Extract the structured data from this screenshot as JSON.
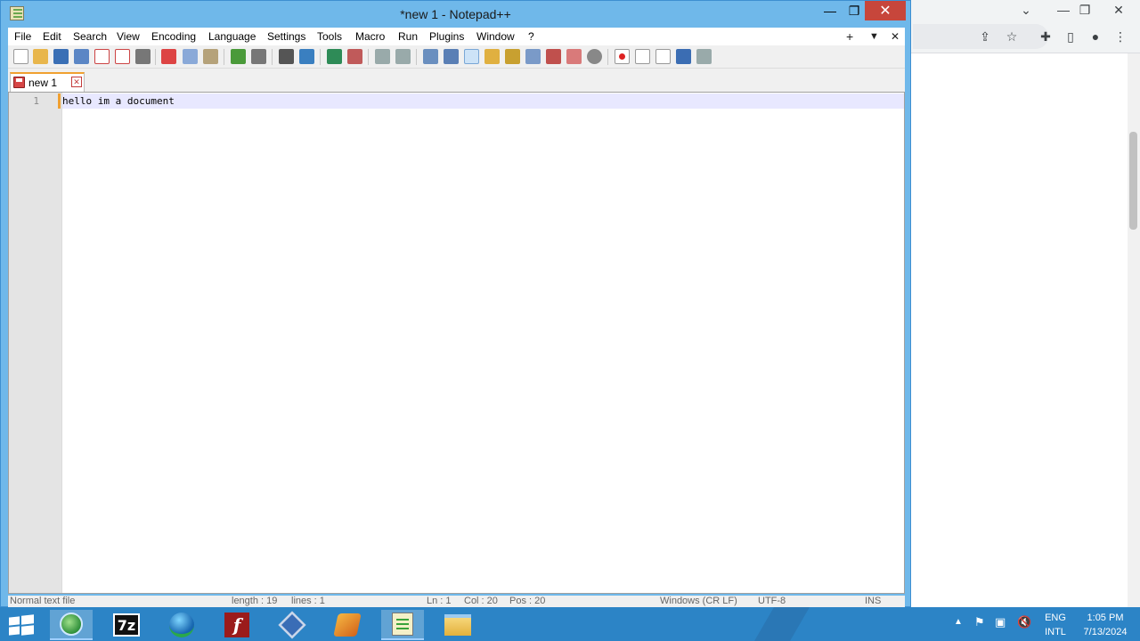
{
  "window": {
    "title": "*new 1 - Notepad++",
    "close_glyph": "✕",
    "minimize_glyph": "—",
    "maximize_glyph": "❐"
  },
  "menu": {
    "items": [
      "File",
      "Edit",
      "Search",
      "View",
      "Encoding",
      "Language",
      "Settings",
      "Tools",
      "Macro",
      "Run",
      "Plugins",
      "Window",
      "?"
    ],
    "right_glyphs": [
      "+",
      "▼",
      "✕"
    ]
  },
  "tabs": [
    {
      "label": "new 1",
      "close_glyph": "✕",
      "modified": true
    }
  ],
  "editor": {
    "line_numbers": [
      "1"
    ],
    "lines": [
      "hello im a document"
    ]
  },
  "status": {
    "file_type": "Normal text file",
    "length": "length : 19",
    "lines": "lines : 1",
    "ln": "Ln : 1",
    "col": "Col : 20",
    "pos": "Pos : 20",
    "eol": "Windows (CR LF)",
    "encoding": "UTF-8",
    "mode": "INS"
  },
  "taskbar": {
    "apps": [
      "start-icon",
      "browser-icon",
      "7zip-icon",
      "internet-download-manager-icon",
      "flash-icon",
      "virtualbox-icon",
      "ftp-client-icon",
      "notepadpp-icon",
      "file-explorer-icon"
    ],
    "seven_zip_label": "7z",
    "lang_top": "ENG",
    "lang_bottom": "INTL",
    "time": "1:05 PM",
    "date": "7/13/2024"
  },
  "colors": {
    "title_bar": "#6fb8ea",
    "taskbar": "#2c84c6",
    "close_button": "#c7463b",
    "current_line": "#e8e8ff",
    "tab_accent": "#f0a030"
  }
}
